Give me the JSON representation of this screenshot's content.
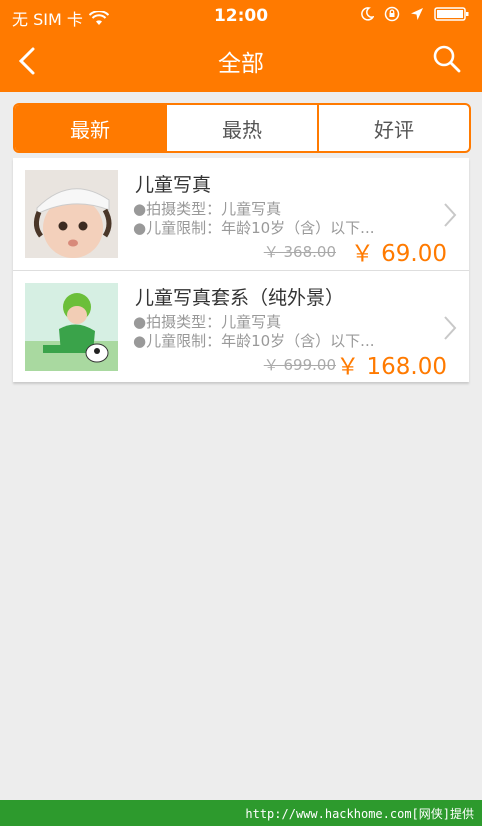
{
  "status_bar": {
    "carrier": "无 SIM 卡",
    "time": "12:00"
  },
  "nav": {
    "title": "全部"
  },
  "tabs": [
    {
      "label": "最新",
      "active": true
    },
    {
      "label": "最热",
      "active": false
    },
    {
      "label": "好评",
      "active": false
    }
  ],
  "products": [
    {
      "title": "儿童写真",
      "type_line": "拍摄类型：儿童写真",
      "limit_line": "儿童限制：年龄10岁（含）以下...",
      "old_price": "￥ 368.00",
      "price": "￥ 69.00"
    },
    {
      "title": "儿童写真套系（纯外景）",
      "type_line": "拍摄类型：儿童写真",
      "limit_line": "儿童限制：年龄10岁（含）以下...",
      "old_price": "￥ 699.00",
      "price": "￥ 168.00"
    }
  ],
  "footer": {
    "text": "http://www.hackhome.com[网侠]提供"
  },
  "colors": {
    "accent": "#ff7a00",
    "footer": "#2d9a2d"
  }
}
